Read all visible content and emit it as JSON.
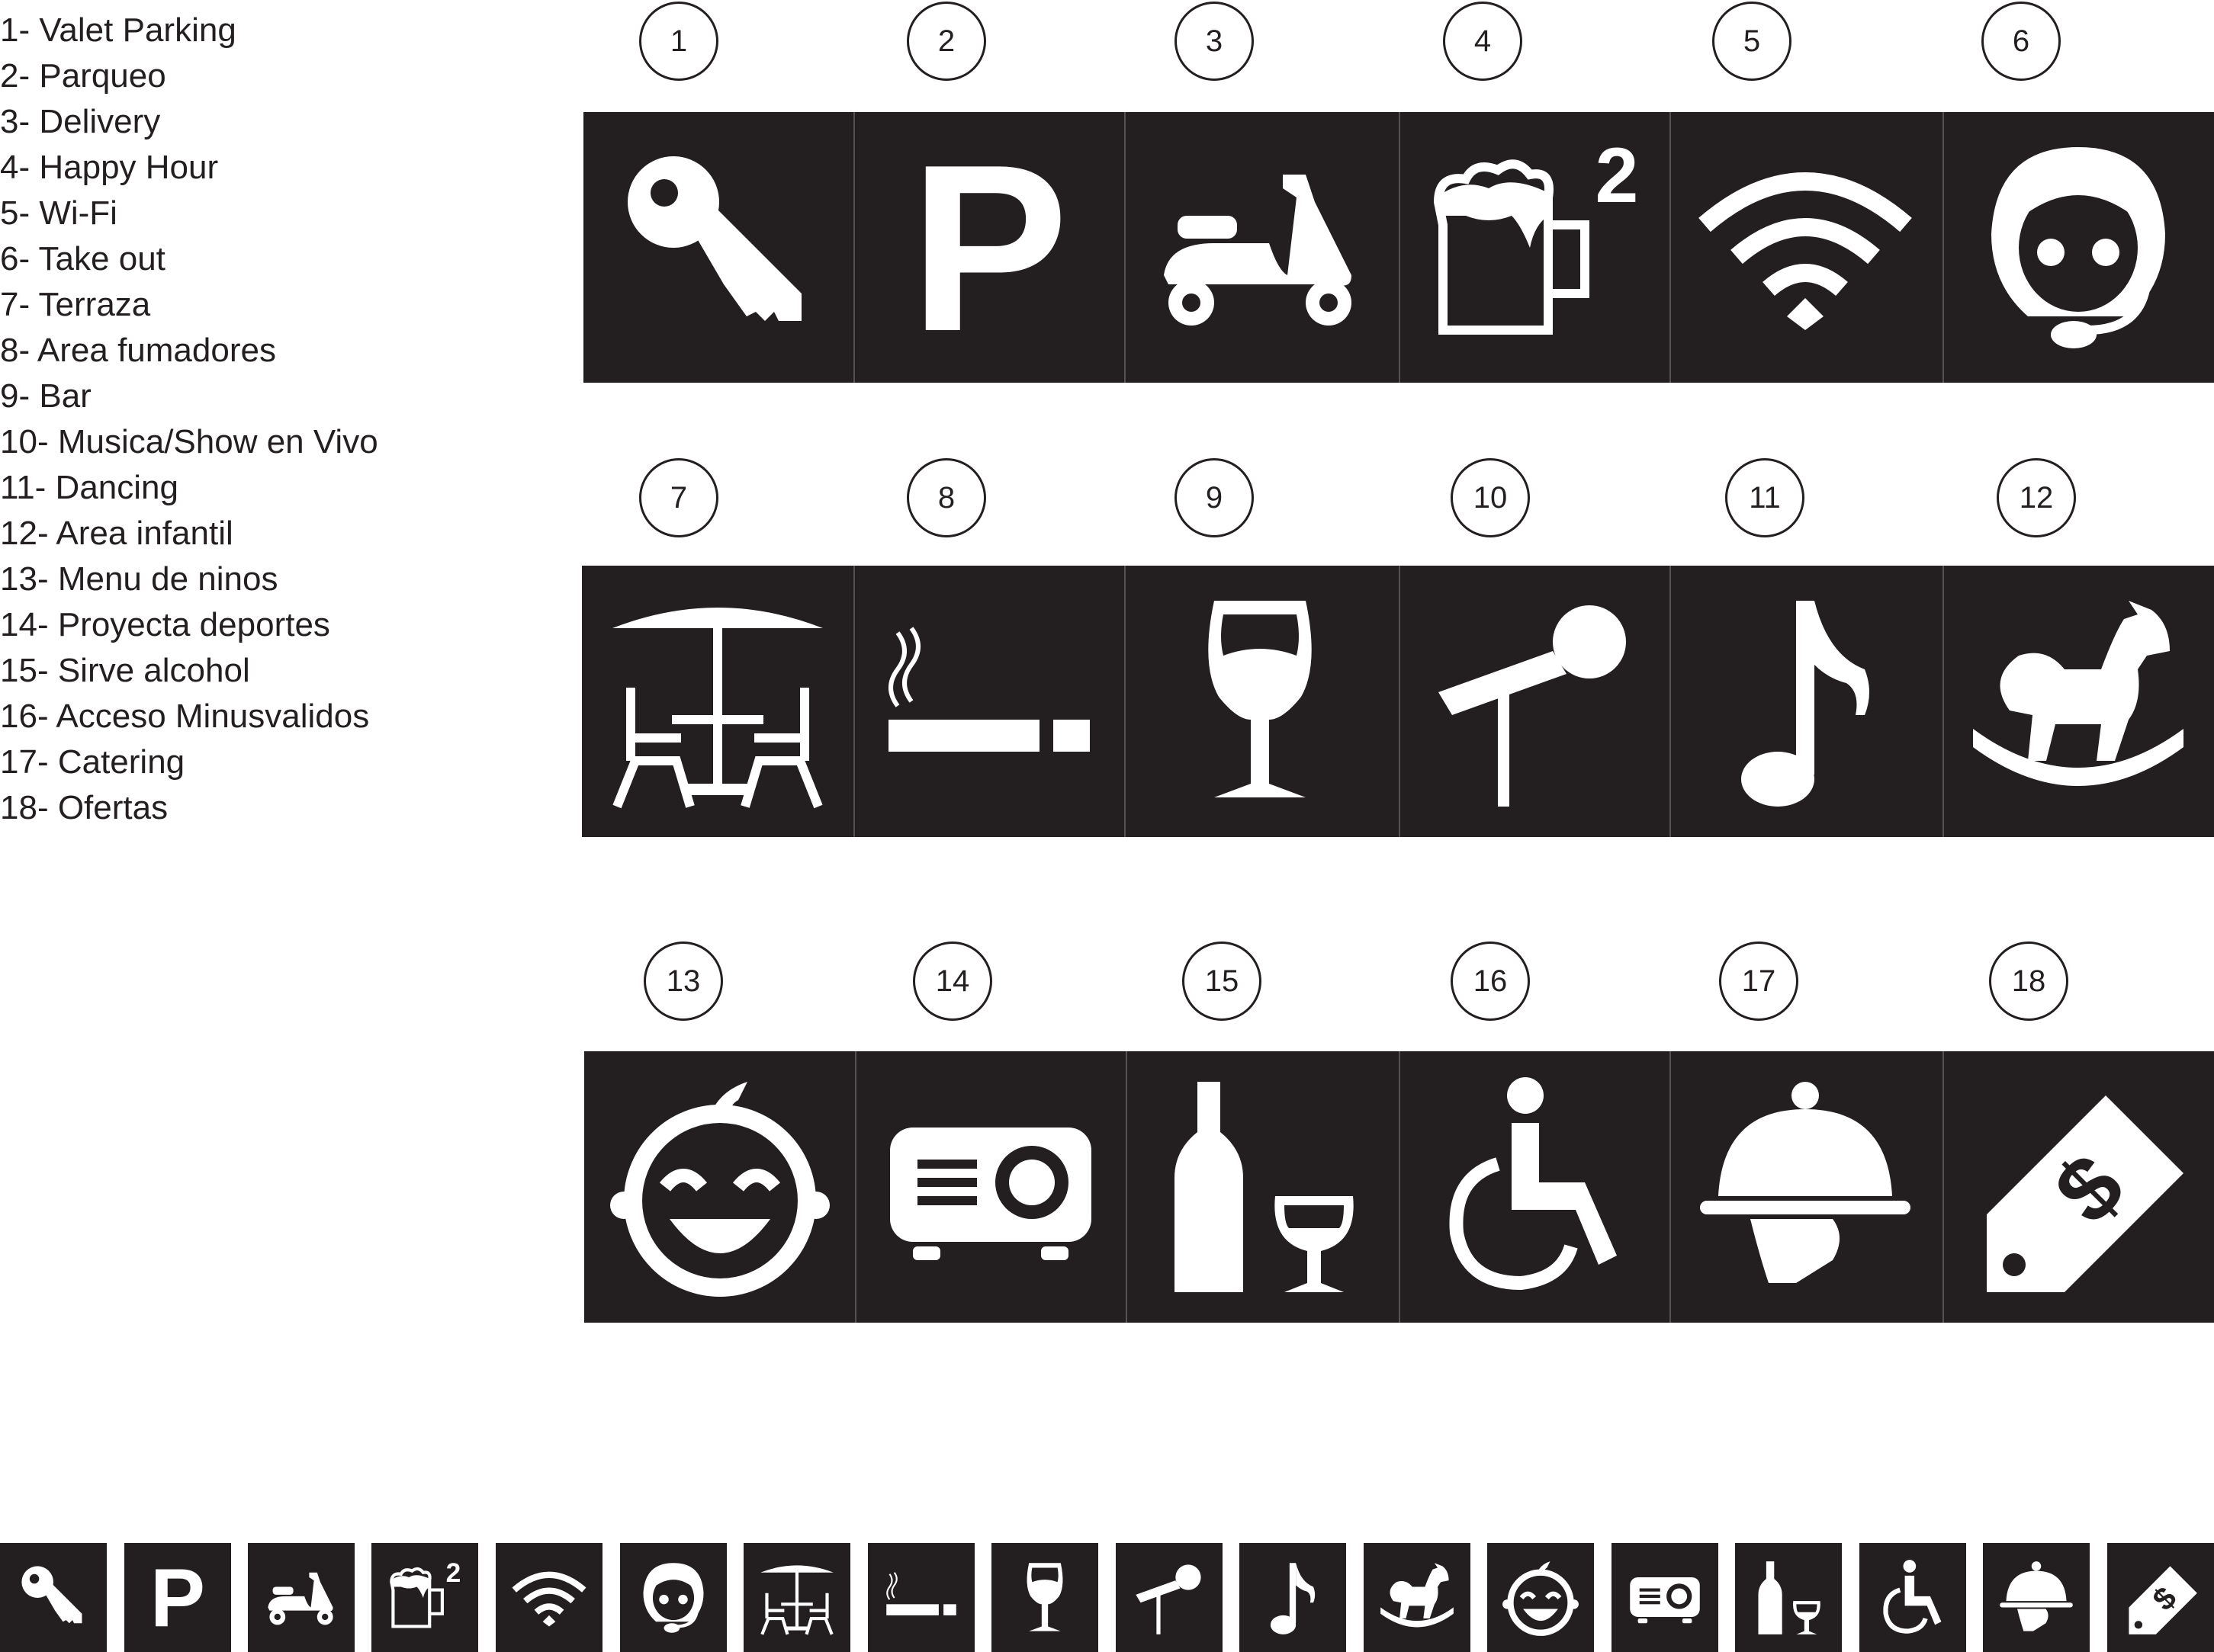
{
  "legend": [
    "1- Valet Parking",
    "2- Parqueo",
    "3- Delivery",
    "4- Happy Hour",
    "5- Wi-Fi",
    "6- Take out",
    "7- Terraza",
    "8- Area fumadores",
    "9- Bar",
    "10- Musica/Show en Vivo",
    "11- Dancing",
    "12- Area infantil",
    "13- Menu de ninos",
    "14- Proyecta deportes",
    "15- Sirve alcohol",
    "16- Acceso Minusvalidos",
    "17- Catering",
    "18- Ofertas"
  ],
  "numbers": [
    "1",
    "2",
    "3",
    "4",
    "5",
    "6",
    "7",
    "8",
    "9",
    "10",
    "11",
    "12",
    "13",
    "14",
    "15",
    "16",
    "17",
    "18"
  ],
  "icons": {
    "parking_letter": "P",
    "happy_hour_superscript": "2",
    "offer_symbol": "$"
  },
  "icon_names": [
    "key-icon",
    "parking-icon",
    "scooter-icon",
    "beer-mug-icon",
    "wifi-icon",
    "headset-icon",
    "terrace-icon",
    "cigarette-icon",
    "wine-glass-icon",
    "microphone-icon",
    "music-note-icon",
    "rocking-horse-icon",
    "baby-face-icon",
    "projector-icon",
    "wine-bottle-icon",
    "wheelchair-icon",
    "cloche-icon",
    "price-tag-icon"
  ],
  "colors": {
    "tile": "#231f20",
    "icon": "#ffffff",
    "text": "#231f20"
  }
}
